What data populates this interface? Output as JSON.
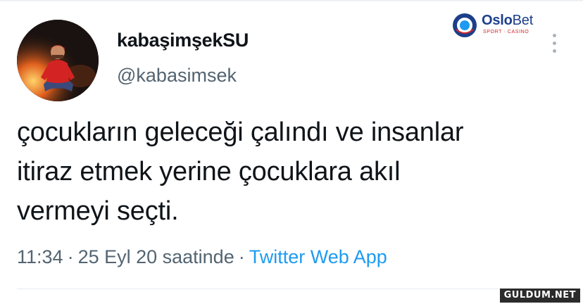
{
  "tweet": {
    "author": {
      "display_name": "kabaşimşekSU",
      "handle": "@kabasimsek"
    },
    "text_lines": [
      "çocukların geleceği çalındı ve insanlar",
      "itiraz etmek yerine çocuklara akıl",
      "vermeyi seçti."
    ],
    "time": "11:34",
    "date": "25 Eyl 20 saatinde",
    "separator": "·",
    "source": "Twitter Web App"
  },
  "brand": {
    "name_bold": "Oslo",
    "name_rest": "Bet",
    "tagline": "SPORT · CASINO",
    "color_primary": "#1d3f8a",
    "color_accent": "#d2242b"
  },
  "watermark": "GULDUM.NET",
  "icons": {
    "avatar": "profile-photo",
    "more": "more-vertical-icon",
    "brand_logo": "oslobet-logo-icon"
  },
  "colors": {
    "text": "#0f1419",
    "secondary": "#536471",
    "link": "#1d9bf0"
  }
}
